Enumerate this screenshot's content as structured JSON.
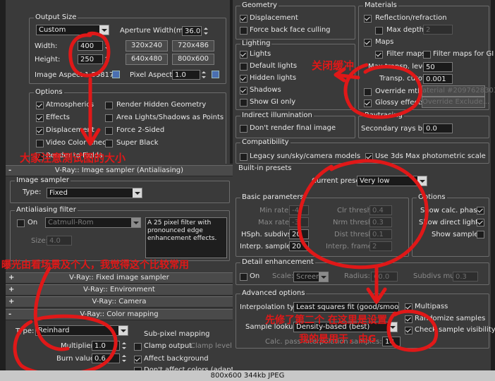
{
  "common": {
    "output_size": {
      "title": "Output Size",
      "preset": "Custom",
      "aperture_label": "Aperture Width(mm):",
      "aperture_value": "36.0",
      "width_label": "Width:",
      "width_value": "400",
      "height_label": "Height:",
      "height_value": "250",
      "presets": [
        "320x240",
        "720x486",
        "640x480",
        "800x600"
      ],
      "image_aspect_label": "Image Aspect:",
      "image_aspect_value": "1.59817",
      "pixel_aspect_label": "Pixel Aspect:",
      "pixel_aspect_value": "1.0"
    },
    "options": {
      "title": "Options",
      "items": [
        {
          "label": "Atmospherics",
          "checked": true
        },
        {
          "label": "Render Hidden Geometry",
          "checked": false
        },
        {
          "label": "Effects",
          "checked": true
        },
        {
          "label": "Area Lights/Shadows as Points",
          "checked": false
        },
        {
          "label": "Displacement",
          "checked": true
        },
        {
          "label": "Force 2-Sided",
          "checked": false
        },
        {
          "label": "Video Color Check",
          "checked": false
        },
        {
          "label": "Super Black",
          "checked": false
        },
        {
          "label": "Render to Fields",
          "checked": false
        }
      ]
    }
  },
  "vray_left": {
    "image_sampler_header": "V-Ray:: Image sampler (Antialiasing)",
    "image_sampler": {
      "title": "Image sampler",
      "type_label": "Type:",
      "type_value": "Fixed"
    },
    "aa_filter": {
      "title": "Antialiasing filter",
      "on_label": "On",
      "filter_value": "Catmull-Rom",
      "description": "A 25 pixel filter with pronounced edge enhancement effects.",
      "size_label": "Size:",
      "size_value": "4.0"
    },
    "rollouts": [
      {
        "sign": "+",
        "label": "V-Ray:: Fixed image sampler"
      },
      {
        "sign": "+",
        "label": "V-Ray:: Environment"
      },
      {
        "sign": "+",
        "label": "V-Ray:: Camera"
      },
      {
        "sign": "-",
        "label": "V-Ray:: Color mapping"
      }
    ],
    "color_mapping": {
      "type_label": "Type:",
      "type_value": "Reinhard",
      "multiplier_label": "Multiplier:",
      "multiplier_value": "1.0",
      "burn_label": "Burn value:",
      "burn_value": "0.6",
      "subpixel_label": "Sub-pixel mapping",
      "clamp_output_label": "Clamp output",
      "clamp_level_label": "Clamp level:",
      "affect_bg_label": "Affect background",
      "dont_affect_label": "Don't affect colors (adaptation only)"
    }
  },
  "right": {
    "geometry": {
      "title": "Geometry",
      "displacement": "Displacement",
      "force_back": "Force back face culling"
    },
    "materials": {
      "title": "Materials",
      "reflection": "Reflection/refraction",
      "max_depth_label": "Max depth",
      "max_depth_value": "2",
      "maps": "Maps",
      "filter_maps": "Filter maps",
      "filter_maps_gi": "Filter maps for GI",
      "max_transp_label": "Max transp. levels",
      "max_transp_value": "50",
      "transp_cutoff_label": "Transp. cutoff",
      "transp_cutoff_value": "0.001",
      "override_mtl": "Override mtl:",
      "override_mtl_button": "aterial #2097628303",
      "glossy": "Glossy effects",
      "override_exclude": "Override Exclude..."
    },
    "lighting": {
      "title": "Lighting",
      "lights": "Lights",
      "default_lights": "Default lights",
      "hidden_lights": "Hidden lights",
      "shadows": "Shadows",
      "show_gi": "Show GI only"
    },
    "raytracing": {
      "title": "Raytracing",
      "bias_label": "Secondary rays bias",
      "bias_value": "0.0"
    },
    "indirect": {
      "title": "Indirect illumination",
      "dont_render": "Don't render final image"
    },
    "compatibility": {
      "title": "Compatibility",
      "legacy": "Legacy sun/sky/camera models",
      "use_3ds": "Use 3ds Max photometric scale"
    },
    "built_in": {
      "title": "Built-in presets",
      "current_preset_label": "Current preset:",
      "current_preset_value": "Very low"
    },
    "basic": {
      "title": "Basic parameters",
      "min_rate_label": "Min rate:",
      "min_rate_value": "-4",
      "max_rate_label": "Max rate:",
      "max_rate_value": "-3",
      "hsph_label": "HSph. subdivs:",
      "hsph_value": "20",
      "interp_label": "Interp. samples:",
      "interp_value": "20",
      "clr_label": "Clr thresh:",
      "clr_value": "0.4",
      "nrm_label": "Nrm thresh:",
      "nrm_value": "0.3",
      "dist_label": "Dist thresh:",
      "dist_value": "0.1",
      "frames_label": "Interp. frames:",
      "frames_value": "2"
    },
    "options": {
      "title": "Options",
      "show_calc": "Show calc. phase",
      "show_direct": "Show direct light",
      "show_samples": "Show samples"
    },
    "detail": {
      "title": "Detail enhancement",
      "on_label": "On",
      "scale_label": "Scale:",
      "scale_value": "Screen",
      "radius_label": "Radius:",
      "radius_value": "60.0",
      "subdivs_label": "Subdivs mult.",
      "subdivs_value": "0.3"
    },
    "advanced": {
      "title": "Advanced options",
      "interp_type_label": "Interpolation type:",
      "interp_type_value": "Least squares fit (good/smoo",
      "sample_lookup_label": "Sample lookup:",
      "sample_lookup_value": "Density-based (best)",
      "calc_pass_label": "Calc. pass interpolation samples:",
      "calc_pass_value": "10",
      "multipass": "Multipass",
      "randomize": "Randomize samples",
      "check_vis": "Check sample visibility"
    }
  },
  "annotations": {
    "left_big_note": "大家注意测试图的大小",
    "right_close": "关闭缓冲",
    "exposure_note": "曝光由看场景及个人，我觉得这个比较常用",
    "preset_note": "先修了第二个   在这里是设置",
    "preset_note2": "我的是用于，由G"
  },
  "status_bar": {
    "text": "800x600  344kb  JPEG"
  },
  "colors": {
    "annotation_red": "#e01818",
    "panel_bg": "#3a3a3a"
  }
}
